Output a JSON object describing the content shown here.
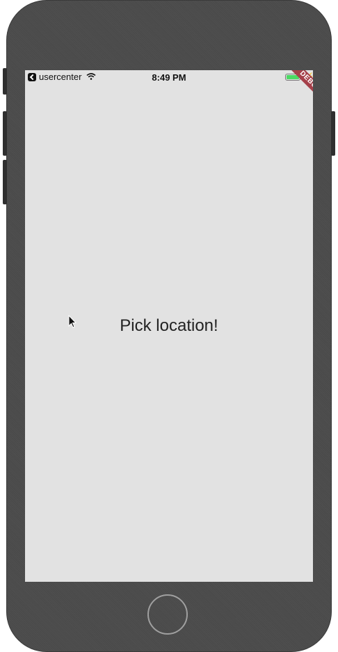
{
  "status_bar": {
    "back_app_label": "usercenter",
    "time": "8:49 PM",
    "battery_level": 1.0,
    "battery_color": "#4cd964"
  },
  "debug_banner": "DEBUG",
  "main": {
    "message": "Pick location!"
  },
  "colors": {
    "device_body": "#4b4b4b",
    "screen_bg": "#e2e2e2",
    "debug_banner_bg": "#a5404a"
  },
  "icons": [
    "back-arrow-icon",
    "wifi-icon",
    "battery-icon",
    "charging-bolt-icon",
    "cursor-icon",
    "home-button"
  ]
}
